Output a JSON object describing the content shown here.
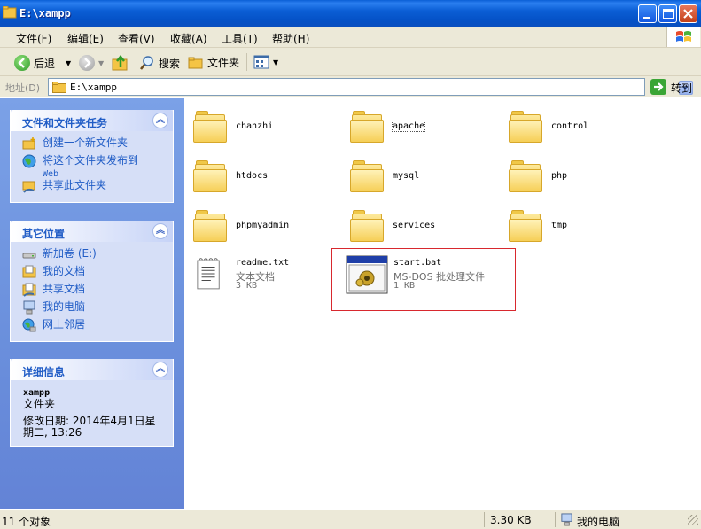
{
  "window": {
    "title": "E:\\xampp"
  },
  "menu": [
    "文件(F)",
    "编辑(E)",
    "查看(V)",
    "收藏(A)",
    "工具(T)",
    "帮助(H)"
  ],
  "toolbar": {
    "back": "后退",
    "search": "搜索",
    "folders": "文件夹"
  },
  "address": {
    "label": "地址(D)",
    "value": "E:\\xampp",
    "go": "转到"
  },
  "tasks": {
    "title": "文件和文件夹任务",
    "items": [
      "创建一个新文件夹",
      "将这个文件夹发布到",
      "Web",
      "共享此文件夹"
    ]
  },
  "places": {
    "title": "其它位置",
    "items": [
      "新加卷 (E:)",
      "我的文档",
      "共享文档",
      "我的电脑",
      "网上邻居"
    ]
  },
  "details": {
    "title": "详细信息",
    "name": "xampp",
    "type": "文件夹",
    "modified": "修改日期: 2014年4月1日星期二, 13:26"
  },
  "folders": [
    "chanzhi",
    "apache",
    "control",
    "htdocs",
    "mysql",
    "php",
    "phpmyadmin",
    "services",
    "tmp"
  ],
  "files": [
    {
      "name": "readme.txt",
      "type": "文本文档",
      "size": "3 KB"
    },
    {
      "name": "start.bat",
      "type": "MS-DOS 批处理文件",
      "size": "1 KB"
    }
  ],
  "status": {
    "objects": "11 个对象",
    "size": "3.30 KB",
    "location": "我的电脑"
  },
  "colors": {
    "title_blue": "#0b5ed5",
    "pane_blue": "#6a8fdc",
    "link_blue": "#215dc6",
    "highlight_red": "#d8282e"
  }
}
